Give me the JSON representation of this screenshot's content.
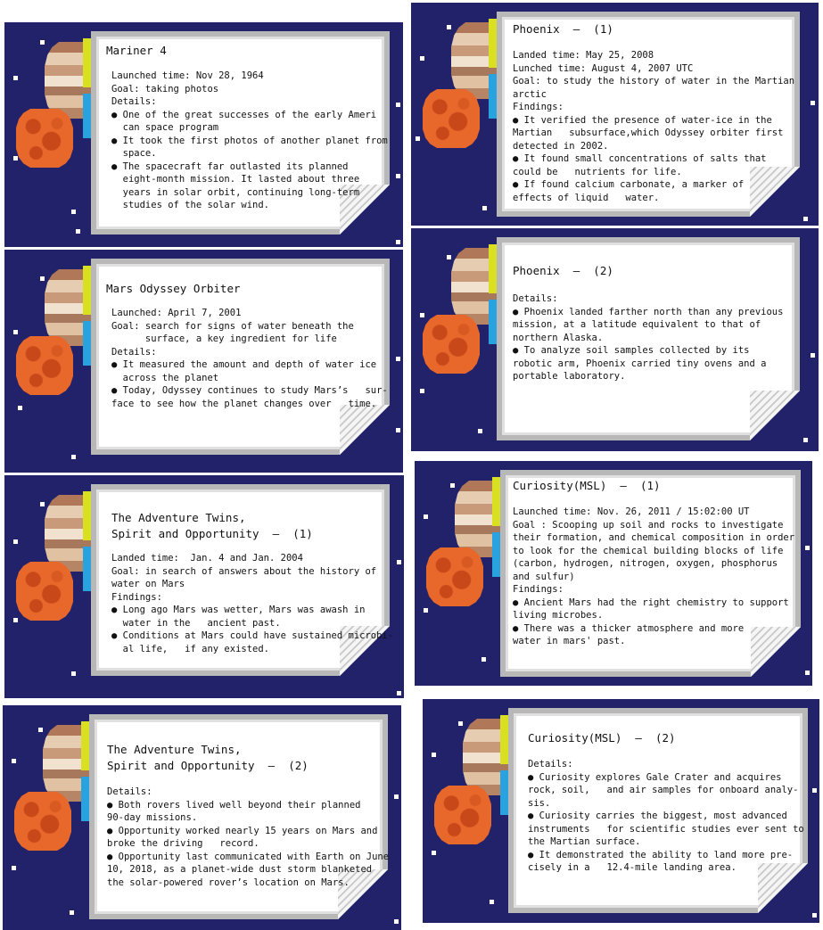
{
  "cards": [
    {
      "id": "mariner-4",
      "title": "Mariner 4",
      "lines": [
        "Launched time: Nov 28, 1964",
        "Goal: taking photos",
        "Details:",
        "● One of the great successes of the early Ameri",
        "  can space program",
        "● It took the first photos of another planet from",
        "  space.",
        "● The spacecraft far outlasted its planned",
        "  eight-month mission. It lasted about three",
        "  years in solar orbit, continuing long-term",
        "  studies of the solar wind."
      ]
    },
    {
      "id": "mars-odyssey-orbiter",
      "title": "Mars Odyssey Orbiter",
      "lines": [
        "Launched: April 7, 2001",
        "Goal: search for signs of water beneath the",
        "      surface, a key ingredient for life",
        "Details:",
        "● It measured the amount and depth of water ice",
        "  across the planet",
        "● Today, Odyssey continues to study Mars’s   sur-",
        "face to see how the planet changes over   time."
      ]
    },
    {
      "id": "adventure-twins-1",
      "title_lines": [
        "The Adventure Twins,",
        "Spirit and Opportunity  –  (1)"
      ],
      "lines": [
        "Landed time:  Jan. 4 and Jan. 2004",
        "Goal: in search of answers about the history of",
        "water on Mars",
        "Findings:",
        "● Long ago Mars was wetter, Mars was awash in",
        "  water in the   ancient past.",
        "● Conditions at Mars could have sustained microbi-",
        "  al life,   if any existed."
      ]
    },
    {
      "id": "adventure-twins-2",
      "title_lines": [
        "The Adventure Twins,",
        "Spirit and Opportunity  –  (2)"
      ],
      "lines": [
        "Details:",
        "● Both rovers lived well beyond their planned",
        "90-day missions.",
        "● Opportunity worked nearly 15 years on Mars and",
        "broke the driving   record.",
        "● Opportunity last communicated with Earth on June",
        "10, 2018, as a planet-wide dust storm blanketed",
        "the solar-powered rover’s location on Mars."
      ]
    },
    {
      "id": "phoenix-1",
      "title": "Phoenix  –  (1)",
      "lines": [
        "Landed time: May 25, 2008",
        "Lunched time: August 4, 2007 UTC",
        "Goal: to study the history of water in the Martian",
        "arctic",
        "Findings:",
        "● It verified the presence of water-ice in the",
        "Martian   subsurface,which Odyssey orbiter first",
        "detected in 2002.",
        "● It found small concentrations of salts that",
        "could be   nutrients for life.",
        "● If found calcium carbonate, a marker of",
        "effects of liquid   water."
      ]
    },
    {
      "id": "phoenix-2",
      "title": "Phoenix  –  (2)",
      "lines": [
        "Details:",
        "● Phoenix landed farther north than any previous",
        "mission, at a latitude equivalent to that of",
        "northern Alaska.",
        "● To analyze soil samples collected by its",
        "robotic arm, Phoenix carried tiny ovens and a",
        "portable laboratory."
      ]
    },
    {
      "id": "curiosity-1",
      "title": "Curiosity(MSL)  –  (1)",
      "lines": [
        "Launched time: Nov. 26, 2011 / 15:02:00 UT",
        "Goal : Scooping up soil and rocks to investigate",
        "their formation, and chemical composition in order",
        "to look for the chemical building blocks of life",
        "(carbon, hydrogen, nitrogen, oxygen, phosphorus",
        "and sulfur)",
        "Findings:",
        "● Ancient Mars had the right chemistry to support",
        "living microbes.",
        "● There was a thicker atmosphere and more",
        "water in mars' past."
      ]
    },
    {
      "id": "curiosity-2",
      "title": "Curiosity(MSL)  –  (2)",
      "lines": [
        "Details:",
        "● Curiosity explores Gale Crater and acquires",
        "rock, soil,   and air samples for onboard analy-",
        "sis.",
        "● Curiosity carries the biggest, most advanced",
        "instruments   for scientific studies ever sent to",
        "the Martian surface.",
        "● It demonstrated the ability to land more pre-",
        "cisely in a   12.4-mile landing area."
      ]
    }
  ],
  "colors": {
    "panel_bg": "#22226a",
    "jupiter": "#e6cdb2",
    "mars": "#e8672a",
    "tab_yellow": "#d9e021",
    "tab_blue": "#29a3e0"
  },
  "icons": [
    "jupiter-icon",
    "mars-icon",
    "star-icon"
  ]
}
